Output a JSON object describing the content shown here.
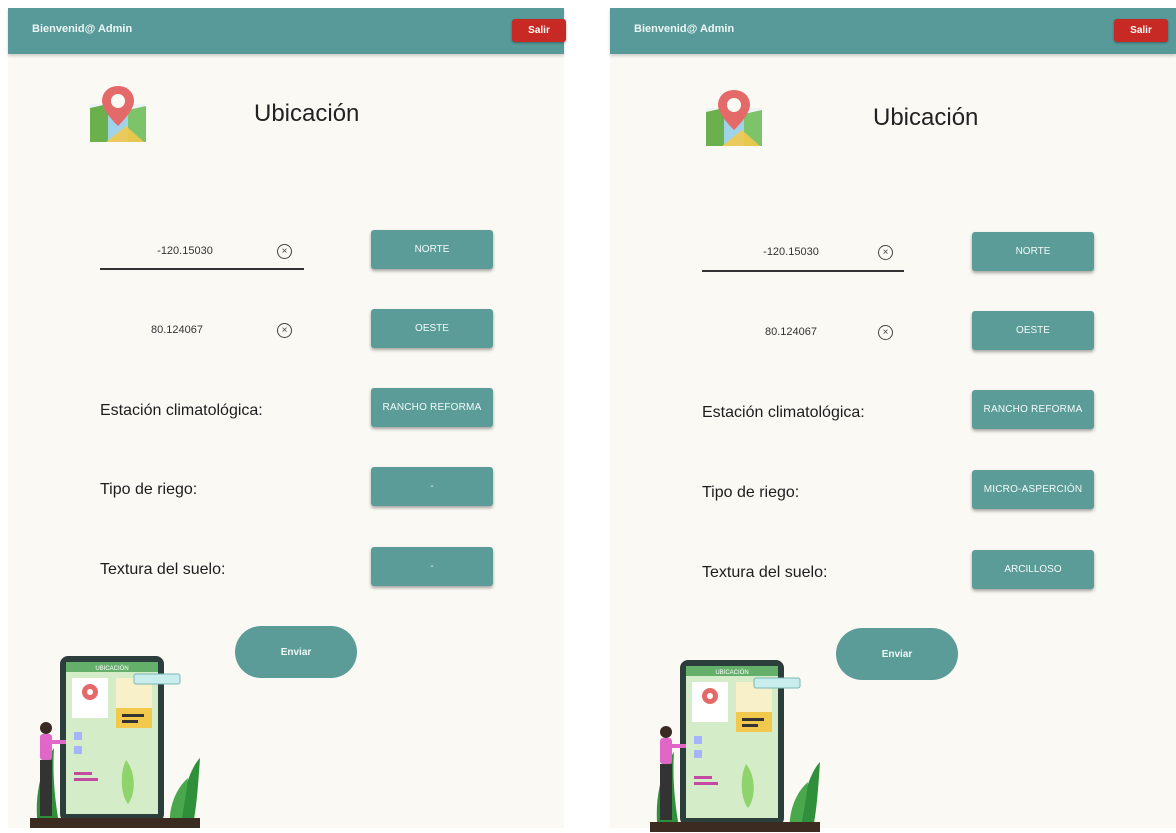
{
  "header": {
    "welcome": "Bienvenid@ Admin",
    "logout_label": "Salir"
  },
  "page": {
    "title": "Ubicación"
  },
  "screens": {
    "left": {
      "latitude": "-120.15030",
      "longitude": "80.124067",
      "north_label": "NORTE",
      "west_label": "OESTE",
      "station_label": "Estación climatológica:",
      "station_value": "RANCHO REFORMA",
      "irrigation_label": "Tipo de riego:",
      "irrigation_value": "-",
      "soil_label": "Textura del suelo:",
      "soil_value": "-",
      "send_label": "Enviar",
      "mockup_header": "UBICACIÓN"
    },
    "right": {
      "latitude": "-120.15030",
      "longitude": "80.124067",
      "north_label": "NORTE",
      "west_label": "OESTE",
      "station_label": "Estación climatológica:",
      "station_value": "RANCHO REFORMA",
      "irrigation_label": "Tipo de riego:",
      "irrigation_value": "MICRO-ASPERCIÓN",
      "soil_label": "Textura del suelo:",
      "soil_value": "ARCILLOSO",
      "send_label": "Enviar",
      "mockup_header": "UBICACIÓN"
    }
  },
  "colors": {
    "topbar": "#579a99",
    "button": "#5b9c99",
    "logout": "#c72a25",
    "background": "#fbf9f4"
  },
  "icons": [
    "map-location-icon",
    "clear-icon",
    "illustration-phone-user"
  ]
}
